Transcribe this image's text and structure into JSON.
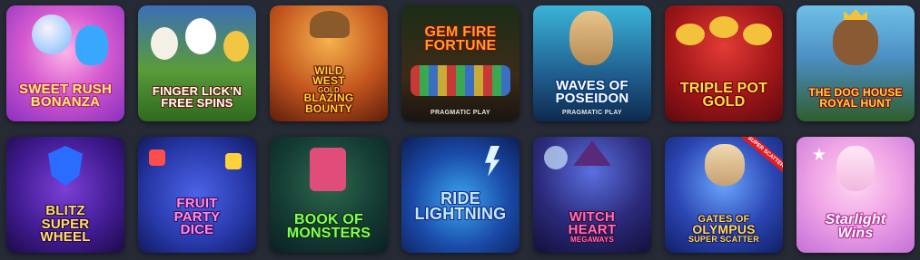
{
  "games": [
    {
      "logo_lines": [
        "Sweet Rush",
        "Bonanza"
      ],
      "provider": "",
      "colors": {
        "text": "#fff06a",
        "stroke": "#b0207f"
      }
    },
    {
      "logo_lines": [
        "Finger Lick'n",
        "Free Spins"
      ],
      "provider": "",
      "colors": {
        "text": "#ffffff",
        "stroke": "#5b2a0d"
      }
    },
    {
      "logo_lines": [
        "Wild",
        "West",
        "Gold",
        "Blazing",
        "Bounty"
      ],
      "provider": "",
      "colors": {
        "text": "#ffd43a",
        "stroke": "#5a1207"
      }
    },
    {
      "logo_lines": [
        "Gem Fire",
        "Fortune"
      ],
      "provider": "PRAGMATIC PLAY",
      "colors": {
        "text": "#ff9c2e",
        "stroke": "#6a1406"
      }
    },
    {
      "logo_lines": [
        "Waves of",
        "Poseidon"
      ],
      "provider": "PRAGMATIC PLAY",
      "colors": {
        "text": "#ffffff",
        "stroke": "#0e3a7a"
      }
    },
    {
      "logo_lines": [
        "Triple Pot",
        "Gold"
      ],
      "provider": "",
      "colors": {
        "text": "#ffdd4d",
        "stroke": "#6a0a0a"
      }
    },
    {
      "logo_lines": [
        "The Dog House",
        "Royal Hunt"
      ],
      "provider": "",
      "colors": {
        "text": "#ffd23f",
        "stroke": "#7a1515"
      }
    },
    {
      "logo_lines": [
        "Blitz",
        "Super",
        "Wheel"
      ],
      "provider": "",
      "colors": {
        "text": "#ffe15a",
        "stroke": "#2a0b55"
      }
    },
    {
      "logo_lines": [
        "Fruit",
        "Party",
        "Dice"
      ],
      "provider": "",
      "colors": {
        "text": "#ff8fd6",
        "stroke": "#3b0f6d"
      }
    },
    {
      "logo_lines": [
        "Book of",
        "Monsters"
      ],
      "provider": "",
      "colors": {
        "text": "#7fff5a",
        "stroke": "#16330d"
      }
    },
    {
      "logo_lines": [
        "Ride",
        "Lightning"
      ],
      "provider": "",
      "colors": {
        "text": "#bfe9ff",
        "stroke": "#1a2f8a"
      }
    },
    {
      "logo_lines": [
        "Witch",
        "Heart",
        "Megaways"
      ],
      "provider": "",
      "colors": {
        "text": "#ff6fb1",
        "stroke": "#3a0b3a"
      }
    },
    {
      "logo_lines": [
        "Gates of",
        "Olympus",
        "Super Scatter"
      ],
      "provider": "",
      "ribbon": "SUPER SCATTER",
      "colors": {
        "text": "#ffd84a",
        "stroke": "#1b1d6a"
      }
    },
    {
      "logo_lines": [
        "Starlight",
        "Wins"
      ],
      "provider": "",
      "colors": {
        "text": "#ffffff",
        "stroke": "#b4349c"
      }
    }
  ]
}
